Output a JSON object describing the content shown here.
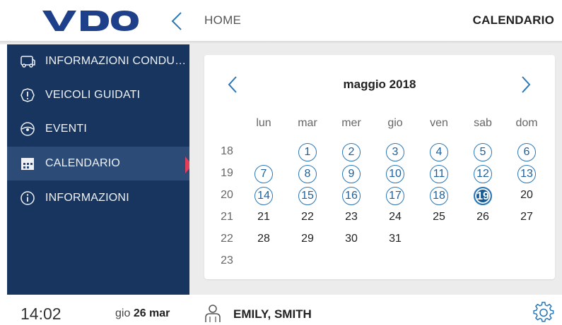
{
  "header": {
    "logo_text": "VDO",
    "home_label": "HOME",
    "current_page": "CALENDARIO"
  },
  "sidebar": {
    "items": [
      {
        "label": "INFORMAZIONI CONDU…",
        "icon": "driver-card-icon",
        "active": false
      },
      {
        "label": "VEICOLI GUIDATI",
        "icon": "warning-circle-icon",
        "active": false
      },
      {
        "label": "EVENTI",
        "icon": "steering-wheel-icon",
        "active": false
      },
      {
        "label": "CALENDARIO",
        "icon": "calendar-icon",
        "active": true
      },
      {
        "label": "INFORMAZIONI",
        "icon": "info-icon",
        "active": false
      }
    ]
  },
  "calendar": {
    "month_title": "maggio 2018",
    "weekdays": [
      "lun",
      "mar",
      "mer",
      "gio",
      "ven",
      "sab",
      "dom"
    ],
    "weeks": [
      "18",
      "19",
      "20",
      "21",
      "22",
      "23"
    ],
    "selected_day": "19",
    "marked_days": [
      "1",
      "2",
      "3",
      "4",
      "5",
      "6",
      "7",
      "8",
      "9",
      "10",
      "11",
      "12",
      "13",
      "14",
      "15",
      "16",
      "17",
      "18",
      "19"
    ],
    "rows": [
      [
        "",
        "1",
        "2",
        "3",
        "4",
        "5",
        "6"
      ],
      [
        "7",
        "8",
        "9",
        "10",
        "11",
        "12",
        "13"
      ],
      [
        "14",
        "15",
        "16",
        "17",
        "18",
        "19",
        "20"
      ],
      [
        "21",
        "22",
        "23",
        "24",
        "25",
        "26",
        "27"
      ],
      [
        "28",
        "29",
        "30",
        "31",
        "",
        "",
        ""
      ],
      [
        "",
        "",
        "",
        "",
        "",
        "",
        ""
      ]
    ]
  },
  "footer": {
    "time": "14:02",
    "date_day": "gio",
    "date_rest": "26 mar",
    "user_name": "EMILY, SMITH"
  },
  "colors": {
    "brand_blue": "#1e3f8a",
    "sidebar_bg": "#17355e",
    "sidebar_active": "#2c4b76",
    "accent_blue": "#2a77b8",
    "active_marker": "#e0405a"
  }
}
